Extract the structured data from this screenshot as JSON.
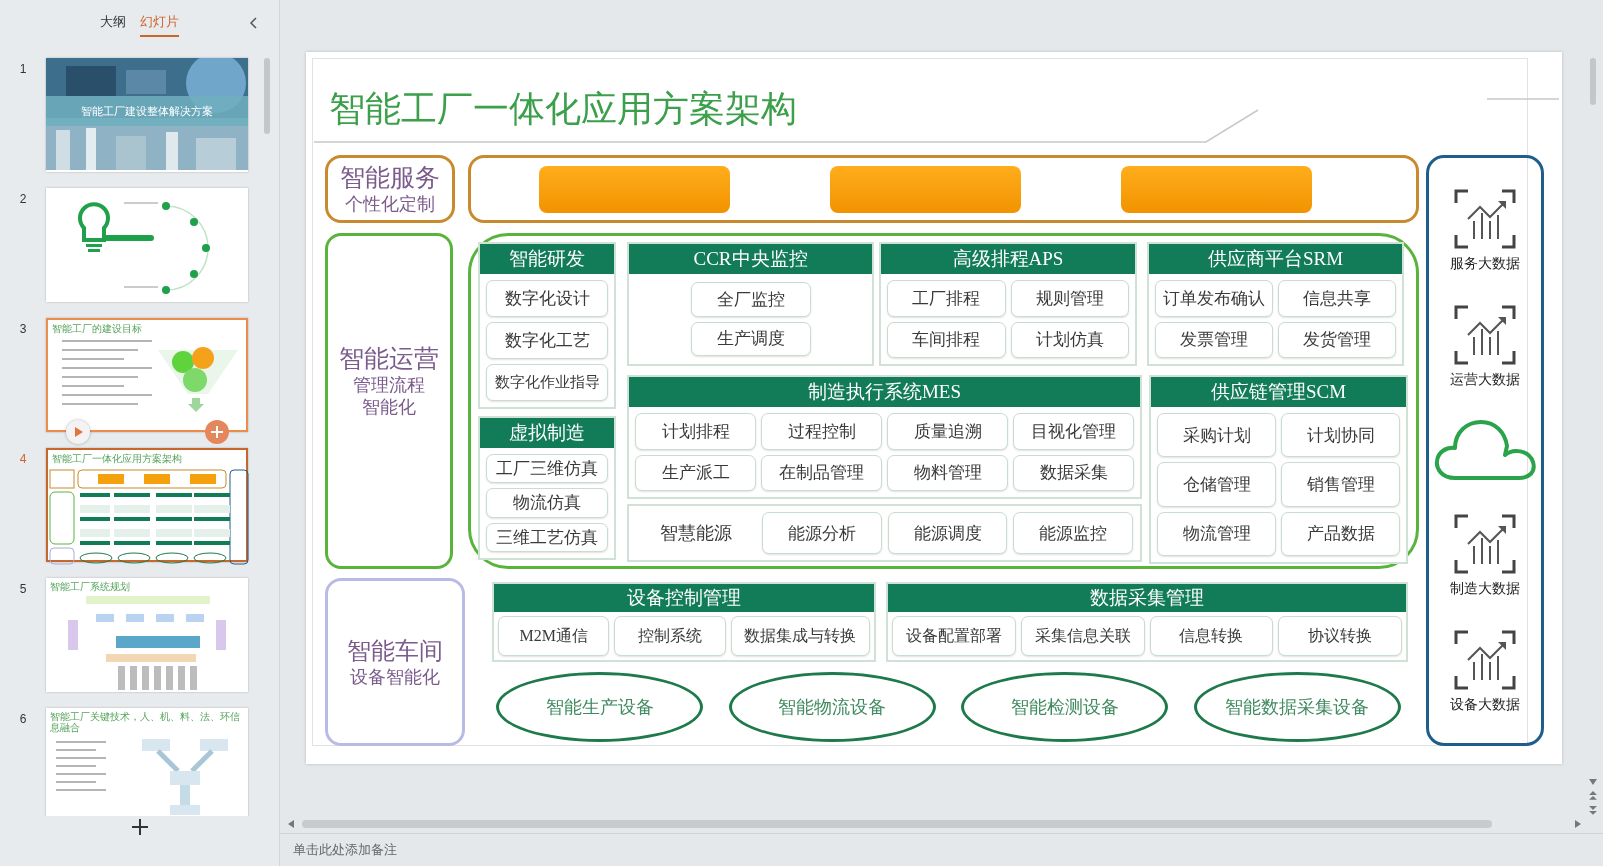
{
  "sidebar": {
    "tabs": [
      {
        "label": "大纲",
        "selected": false
      },
      {
        "label": "幻灯片",
        "selected": true
      }
    ],
    "slides": [
      {
        "number": "1",
        "kind": "cover",
        "title": "智能工厂建设整体解决方案",
        "selected": false,
        "hovered": false
      },
      {
        "number": "2",
        "kind": "contents",
        "selected": false,
        "hovered": false
      },
      {
        "number": "3",
        "kind": "funnel",
        "title": "智能工厂的建设目标",
        "selected": false,
        "hovered": true
      },
      {
        "number": "4",
        "kind": "diagram",
        "title": "智能工厂一体化应用方案架构",
        "selected": true,
        "hovered": false
      },
      {
        "number": "5",
        "kind": "flowchart",
        "title": "智能工厂系统规划",
        "selected": false,
        "hovered": false
      },
      {
        "number": "6",
        "kind": "network",
        "title": "智能工厂关键技术，人、机、料、法、环信息融合",
        "selected": false,
        "hovered": false
      }
    ]
  },
  "slide": {
    "title": "智能工厂一体化应用方案架构",
    "service": {
      "title": "智能服务",
      "subtitle_lines": [
        "个性化定制"
      ]
    },
    "operation": {
      "title": "智能运营",
      "subtitle_lines": [
        "管理流程",
        "智能化"
      ]
    },
    "workshop": {
      "title": "智能车间",
      "subtitle_lines": [
        "设备智能化"
      ]
    },
    "modules": [
      {
        "kind": "list",
        "title": "智能研发",
        "items": [
          "数字化设计",
          "数字化工艺",
          "数字化作业指导"
        ]
      },
      {
        "kind": "list",
        "title": "虚拟制造",
        "items": [
          "工厂三维仿真",
          "物流仿真",
          "三维工艺仿真"
        ]
      },
      {
        "kind": "list",
        "title": "CCR中央监控",
        "items": [
          "全厂监控",
          "生产调度"
        ]
      },
      {
        "kind": "grid",
        "title": "高级排程APS",
        "items": [
          "工厂排程",
          "规则管理",
          "车间排程",
          "计划仿真"
        ]
      },
      {
        "kind": "grid",
        "title": "供应商平台SRM",
        "items": [
          "订单发布确认",
          "信息共享",
          "发票管理",
          "发货管理"
        ]
      },
      {
        "kind": "grid",
        "title": "制造执行系统MES",
        "items": [
          "计划排程",
          "过程控制",
          "质量追溯",
          "目视化管理",
          "生产派工",
          "在制品管理",
          "物料管理",
          "数据采集"
        ]
      },
      {
        "kind": "labeled",
        "label": "智慧能源",
        "items": [
          "能源分析",
          "能源调度",
          "能源监控"
        ]
      },
      {
        "kind": "grid",
        "title": "供应链管理SCM",
        "items": [
          "采购计划",
          "计划协同",
          "仓储管理",
          "销售管理",
          "物流管理",
          "产品数据"
        ]
      },
      {
        "kind": "grid",
        "title": "设备控制管理",
        "items": [
          "M2M通信",
          "控制系统",
          "数据集成与转换"
        ]
      },
      {
        "kind": "grid",
        "title": "数据采集管理",
        "items": [
          "设备配置部署",
          "采集信息关联",
          "信息转换",
          "协议转换"
        ]
      }
    ],
    "devices": [
      "智能生产设备",
      "智能物流设备",
      "智能检测设备",
      "智能数据采集设备"
    ],
    "big_data": [
      {
        "kind": "data",
        "label": "服务大数据"
      },
      {
        "kind": "data",
        "label": "运营大数据"
      },
      {
        "kind": "cloud"
      },
      {
        "kind": "data",
        "label": "制造大数据"
      },
      {
        "kind": "data",
        "label": "设备大数据"
      }
    ]
  },
  "notes": {
    "placeholder": "单击此处添加备注"
  }
}
